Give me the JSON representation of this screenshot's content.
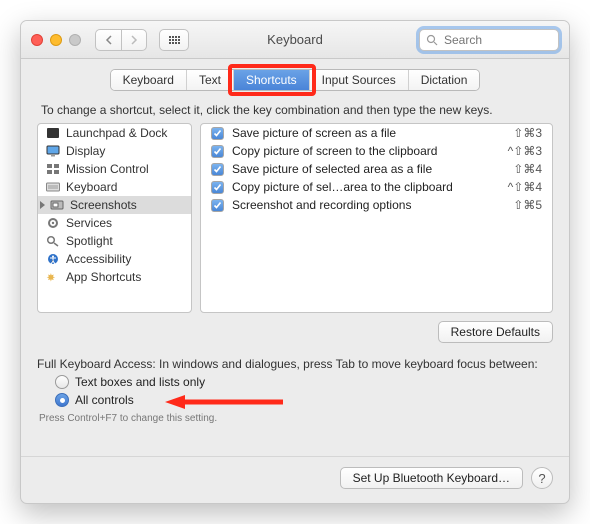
{
  "window": {
    "title": "Keyboard",
    "search_placeholder": "Search"
  },
  "tabs": [
    {
      "label": "Keyboard",
      "active": false
    },
    {
      "label": "Text",
      "active": false
    },
    {
      "label": "Shortcuts",
      "active": true
    },
    {
      "label": "Input Sources",
      "active": false
    },
    {
      "label": "Dictation",
      "active": false
    }
  ],
  "description": "To change a shortcut, select it, click the key combination and then type the new keys.",
  "categories": [
    {
      "label": "Launchpad & Dock",
      "icon": "launchpad"
    },
    {
      "label": "Display",
      "icon": "display"
    },
    {
      "label": "Mission Control",
      "icon": "mission"
    },
    {
      "label": "Keyboard",
      "icon": "keyboard"
    },
    {
      "label": "Screenshots",
      "icon": "screenshots",
      "selected": true
    },
    {
      "label": "Services",
      "icon": "services"
    },
    {
      "label": "Spotlight",
      "icon": "spotlight"
    },
    {
      "label": "Accessibility",
      "icon": "accessibility"
    },
    {
      "label": "App Shortcuts",
      "icon": "app"
    }
  ],
  "shortcuts": [
    {
      "checked": true,
      "label": "Save picture of screen as a file",
      "keys": "⇧⌘3"
    },
    {
      "checked": true,
      "label": "Copy picture of screen to the clipboard",
      "keys": "^⇧⌘3"
    },
    {
      "checked": true,
      "label": "Save picture of selected area as a file",
      "keys": "⇧⌘4"
    },
    {
      "checked": true,
      "label": "Copy picture of sel…area to the clipboard",
      "keys": "^⇧⌘4"
    },
    {
      "checked": true,
      "label": "Screenshot and recording options",
      "keys": "⇧⌘5"
    }
  ],
  "restore_defaults": "Restore Defaults",
  "fka": {
    "description": "Full Keyboard Access: In windows and dialogues, press Tab to move keyboard focus between:",
    "options": [
      {
        "label": "Text boxes and lists only",
        "checked": false
      },
      {
        "label": "All controls",
        "checked": true
      }
    ],
    "hint": "Press Control+F7 to change this setting."
  },
  "footer": {
    "bluetooth": "Set Up Bluetooth Keyboard…",
    "help": "?"
  }
}
